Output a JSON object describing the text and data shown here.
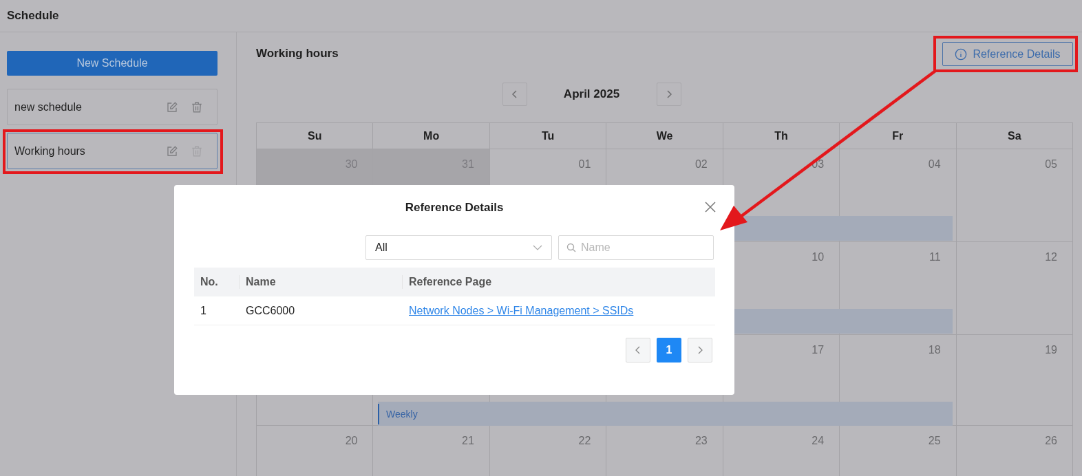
{
  "header": {
    "title": "Schedule"
  },
  "sidebar": {
    "new_button": "New Schedule",
    "items": [
      {
        "name": "new schedule",
        "selected": false,
        "delete_disabled": false
      },
      {
        "name": "Working hours",
        "selected": true,
        "delete_disabled": true
      }
    ]
  },
  "main": {
    "title": "Working hours",
    "reference_button": "Reference Details",
    "month": "April 2025",
    "weekdays": [
      "Su",
      "Mo",
      "Tu",
      "We",
      "Th",
      "Fr",
      "Sa"
    ],
    "weeks": [
      {
        "has_event": true,
        "days": [
          {
            "date": "30",
            "in_month": false
          },
          {
            "date": "31",
            "in_month": false
          },
          {
            "date": "01",
            "in_month": true
          },
          {
            "date": "02",
            "in_month": true
          },
          {
            "date": "03",
            "in_month": true
          },
          {
            "date": "04",
            "in_month": true
          },
          {
            "date": "05",
            "in_month": true
          }
        ]
      },
      {
        "has_event": true,
        "days": [
          {
            "date": "10",
            "in_month": true
          },
          {
            "date": "11",
            "in_month": true
          },
          {
            "date": "12",
            "in_month": true
          }
        ]
      },
      {
        "has_event": true,
        "event_label": "Weekly",
        "days": [
          {
            "in_month": true
          },
          {
            "in_month": true
          },
          {
            "in_month": true
          },
          {
            "in_month": true
          },
          {
            "date": "17",
            "in_month": true
          },
          {
            "date": "18",
            "in_month": true
          },
          {
            "date": "19",
            "in_month": true
          }
        ]
      },
      {
        "days": [
          {
            "date": "20",
            "in_month": true
          },
          {
            "date": "21",
            "in_month": true
          },
          {
            "date": "22",
            "in_month": true
          },
          {
            "date": "23",
            "in_month": true
          },
          {
            "date": "24",
            "in_month": true
          },
          {
            "date": "25",
            "in_month": true
          },
          {
            "date": "26",
            "in_month": true
          }
        ]
      }
    ]
  },
  "dialog": {
    "title": "Reference Details",
    "filter": {
      "value": "All"
    },
    "search": {
      "placeholder": "Name"
    },
    "columns": [
      "No.",
      "Name",
      "Reference Page"
    ],
    "rows": [
      {
        "no": "1",
        "name": "GCC6000",
        "page": "Network Nodes > Wi-Fi Management > SSIDs"
      }
    ],
    "pages": [
      {
        "label": "1",
        "selected": true
      }
    ]
  }
}
